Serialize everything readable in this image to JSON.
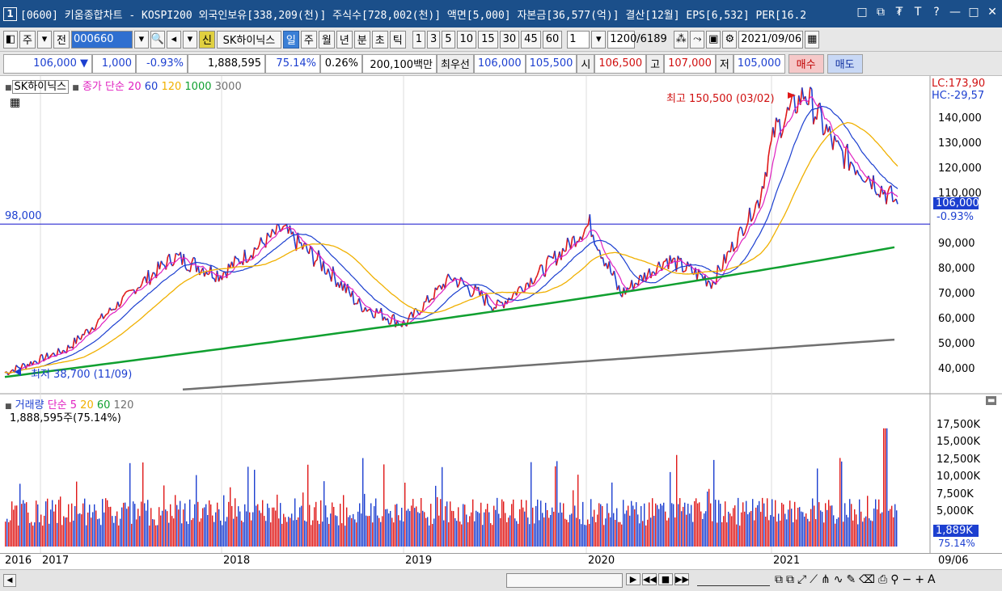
{
  "window": {
    "number": "1",
    "title": "[0600] 키움종합차트 - KOSPI200 외국인보유[338,209(천)] 주식수[728,002(천)] 액면[5,000] 자본금[36,577(억)] 결산[12월] EPS[6,532] PER[16.2"
  },
  "toolbar1": {
    "period_unit": "주",
    "prev_label": "전",
    "code": "000660",
    "credit_label": "신",
    "stock_name": "SK하이닉스",
    "tabs": [
      "일",
      "주",
      "월",
      "년",
      "분",
      "초",
      "틱"
    ],
    "active_tab": "일",
    "intervals": [
      "1",
      "3",
      "5",
      "10",
      "15",
      "30",
      "45",
      "60"
    ],
    "interval_select": "1",
    "count": "1200",
    "total": "/6189",
    "date": "2021/09/06"
  },
  "quote": {
    "price": "106,000",
    "direction": "▼",
    "change": "1,000",
    "change_pct": "-0.93%",
    "volume": "1,888,595",
    "vol_ratio": "75.14%",
    "turnover": "0.26%",
    "amount": "200,100백만",
    "best_label": "최우선",
    "best_ask": "106,000",
    "best_bid": "105,500",
    "open_label": "시",
    "open": "106,500",
    "high_label": "고",
    "high": "107,000",
    "low_label": "저",
    "low": "105,000",
    "buy_label": "매수",
    "sell_label": "매도"
  },
  "price_pane": {
    "stock_label": "SK하이닉스",
    "ma_label": "종가 단순",
    "ma_periods": [
      "20",
      "60",
      "120",
      "1000",
      "3000"
    ],
    "ma_colors": [
      "#e020c0",
      "#1c3fd0",
      "#f0b000",
      "#10a030",
      "#707070"
    ],
    "lc": "LC:173,90",
    "hc": "HC:-29,57",
    "y_ticks": [
      "140,000",
      "130,000",
      "120,000",
      "110,000",
      "90,000",
      "80,000",
      "70,000",
      "60,000",
      "50,000",
      "40,000"
    ],
    "current_price": "106,000",
    "current_pct": "-0.93%",
    "hline_label": "98,000",
    "max_annotation": "최고 150,500 (03/02)",
    "min_annotation": "최저 38,700 (11/09)"
  },
  "volume_pane": {
    "label": "거래량",
    "ma_label": "단순",
    "ma_periods": [
      "5",
      "20",
      "60",
      "120"
    ],
    "ma_colors": [
      "#e020c0",
      "#f0b000",
      "#10a030",
      "#707070"
    ],
    "value_text": "1,888,595주(75.14%)",
    "y_ticks": [
      "17,500K",
      "15,000K",
      "12,500K",
      "10,000K",
      "7,500K",
      "5,000K"
    ],
    "current": "1,889K",
    "current_pct": "75.14%"
  },
  "x_axis": {
    "labels": [
      "2016",
      "2017",
      "2018",
      "2019",
      "2020",
      "2021"
    ],
    "end_date": "09/06"
  },
  "chart_data": {
    "type": "line",
    "series": [
      {
        "name": "SK하이닉스",
        "x": [
          "2016-11",
          "2017-03",
          "2017-08",
          "2017-10",
          "2018-01",
          "2018-05",
          "2018-08",
          "2018-10",
          "2019-01",
          "2019-04",
          "2019-07",
          "2019-10",
          "2020-01",
          "2020-03",
          "2020-06",
          "2020-09",
          "2020-12",
          "2021-01",
          "2021-03",
          "2021-05",
          "2021-07",
          "2021-09"
        ],
        "values": [
          38700,
          48000,
          75000,
          85000,
          78000,
          96000,
          80000,
          66000,
          58000,
          77000,
          65000,
          80000,
          98000,
          70000,
          84000,
          75000,
          108000,
          135000,
          150500,
          128000,
          118000,
          106000
        ]
      }
    ],
    "ylim": [
      30000,
      175000
    ]
  }
}
